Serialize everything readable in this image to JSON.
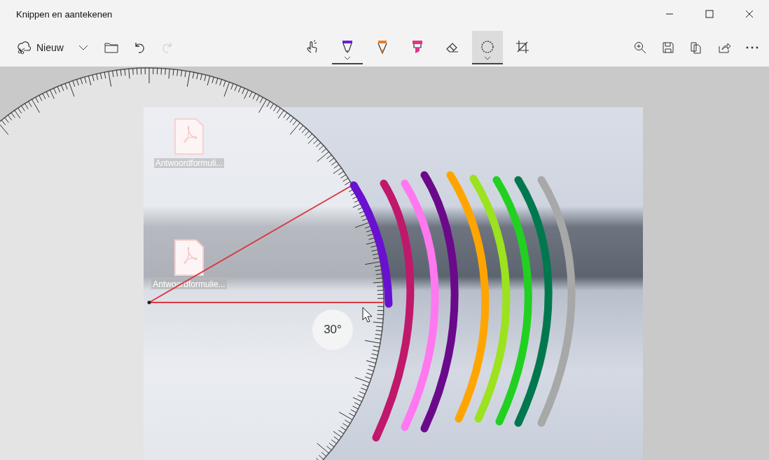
{
  "window": {
    "title": "Knippen en aantekenen"
  },
  "toolbar": {
    "new_label": "Nieuw",
    "left": [
      {
        "kind": "dropdown",
        "disabled": false
      },
      {
        "kind": "open",
        "disabled": false
      },
      {
        "kind": "undo",
        "disabled": false
      },
      {
        "kind": "redo",
        "disabled": true
      }
    ],
    "tools": [
      {
        "kind": "touch",
        "selected": false
      },
      {
        "kind": "ballpoint",
        "selected": true,
        "color": "#6a1fd0"
      },
      {
        "kind": "pencil",
        "selected": false,
        "color": "#f07a20"
      },
      {
        "kind": "highlighter",
        "selected": false,
        "color": "#e8308a"
      },
      {
        "kind": "eraser",
        "selected": false
      },
      {
        "kind": "protractor",
        "selected": true
      },
      {
        "kind": "crop",
        "selected": false
      }
    ],
    "right": [
      {
        "kind": "zoom"
      },
      {
        "kind": "save"
      },
      {
        "kind": "copy"
      },
      {
        "kind": "share"
      },
      {
        "kind": "more"
      }
    ]
  },
  "canvas": {
    "desktop_icons": [
      {
        "label": "Antwoordformuli..."
      },
      {
        "label": "Antwoordformulie..."
      }
    ],
    "angle_label": "30°",
    "strokes": [
      {
        "color": "#6a10d0"
      },
      {
        "color": "#c0186a"
      },
      {
        "color": "#ff78f0"
      },
      {
        "color": "#6a0a8a"
      },
      {
        "color": "#ffa500"
      },
      {
        "color": "#9ce21e"
      },
      {
        "color": "#22d022"
      },
      {
        "color": "#00784e"
      },
      {
        "color": "#a8a8a8"
      }
    ]
  }
}
